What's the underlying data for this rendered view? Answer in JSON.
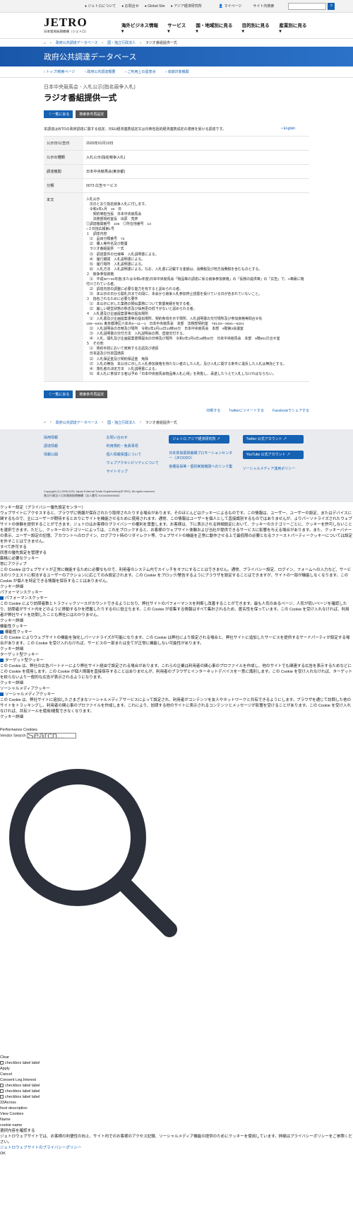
{
  "util": {
    "items": [
      "ジェトロについて",
      "お問合せ",
      "Global Site",
      "アジア経済研究所",
      "マイページ"
    ],
    "search_placeholder": "サイト内検索"
  },
  "header": {
    "logo": "JETRO",
    "logo_sub": "日本貿易振興機構（ジェトロ）",
    "gnav": [
      "海外ビジネス情報 ▾",
      "サービス ▾",
      "国・地域別に見る ▾",
      "目的別に見る ▾",
      "産業別に見る ▾"
    ]
  },
  "breadcrumb": [
    "政府公共調達データベース",
    "国・独立行政法人",
    "ラジオ番組提供一式"
  ],
  "bluebar": "政府公共調達データベース",
  "subnav": [
    "トップ/検索ページ",
    "政府公共調達概要",
    "ご利用上の留意点",
    "収録対象機関"
  ],
  "page": {
    "org": "日本中央競馬会 - 入札公示(指名競争入札)",
    "title": "ラジオ番組提供一式",
    "back_btn": "〈 一覧に戻る",
    "search_btn": "検索条件再設定",
    "note": "本調達はWTOの政府調達に関する協定、日EU経済連携協定又は日英包括的経済連携協定の適用を受ける調達です。",
    "english": "English"
  },
  "table": [
    {
      "label": "公示日/公告日",
      "value": "2020年01月10日"
    },
    {
      "label": "公示の種類",
      "value": "入札公示(指名競争入札)"
    },
    {
      "label": "調達機関",
      "value": "日本中央競馬会(東京都)"
    },
    {
      "label": "分類",
      "value": "0073 広告サービス"
    },
    {
      "label": "本文",
      "value": "入札公示\n　次のとおり指名競争入札に付します。\n　令和2年1月　10　日\n　　契約等担当役　日本中央競馬会\n　　法務部契約室長　出原　亮彦\n◎調達機関番号　236　◎所在地番号　13\n○２日指広報第1号\n１　調達内容\n　⑴　品目分類番号　73\n　⑵　購入等件名及び数量\n　ラジオ番組提供　一式\n　⑶　調達案件の仕様等　入札説明書による。\n　⑷　履行期間　入札説明書による。\n　⑸　履行場所　入札説明書による。\n　⑹　入札方法　入札説明書による。なお、入札書に記載する金額は、消費税及び地方消費税を含むものとする。\n２　競争参加資格\n　⑴　平成30～32年度(または令和2年度)日本中央競馬会「物品等の調達に係る競争参加資格」の「役務の提供等」の「広告」で、A等級に格付けされている者。\n　⑵　調達内容の調整に必要な能力を有すると認められる者。\n　⑶　本公示の日から開札日までの間に、本会から競争入札参加停止措置を受けている日が含まれていないこと。\n３　指名されるために必要な要件\n　⑴　本公示に示した業務の類似業務について数量実績を有する者。\n　⑵　厳しい経営状態の懸念及び採用更の低下がないと認められる者。\n４　入札書及び企画提案書等の提出場所\n　⑴　入札書及び企画提案書等の提出場所、契約条項を示す場所、入札説明書の交付場所及び参加資格等問合せ先\n106―8401 東京都港区六本木6―11―1　日本中央競馬会　本部　法務部契約室　TEL03―3591―5251\n　⑵　入札説明会の日時及び場所　令和2年2月14日13時30分　日本中央競馬会　本部　9階第3会議室\n　⑶　入札説明書の交付方法　入札説明会の際、直接交付する。\n　⑷　入札、開札及び企画提案書類提出の日時及び場所　令和2年3月5日16時30分　日本中央競馬会　本部　9階901打合せ室\n５　その他\n　⑴　契約手続において使用する言語及び通貨\n　日本語及び日本国通貨\n　⑵　入札保証金及び契約保証金　免除\n　⑶　入札の無効　本公示に示した入札参加資格を持たない者のした入札、及び入札に関する条件に違反した入札は無効とする。\n　⑷　落札者の決定方法　入札説明書による。\n　⑸　本入札に参加する者は予め「日本中央競馬会物品等入札心得」を熟覧し、承諾したうえで入札しなければならない。"
    }
  ],
  "share": [
    "印刷する",
    "Twitterにツイートする",
    "Facebookでシェアする"
  ],
  "footer": {
    "col1": [
      "採用情報",
      "調達情報",
      "情報公開"
    ],
    "col2": [
      "お問い合わせ",
      "利用規約・免責事項",
      "個人情報保護について",
      "ウェブアクセシビリティについて",
      "サイトマップ"
    ],
    "btn1": "ジェトロ アジア経済研究所 ↗",
    "list3": [
      "日本貿易振興機構プロモーションセンター（JFOODO）",
      "各種役員等・個別実施機関へのリンク集"
    ],
    "btn2": "Twitter 公式アカウント ↗",
    "btn3": "YouTube 公式アカウント ↗",
    "list4": [
      "ソーシャルメディア運用ポリシー"
    ],
    "copy1": "Copyright (C) 1995-2021 Japan External Trade Organization(JETRO). All rights reserved.",
    "copy2": "独立行政法人日本貿易振興機構（法人番号 2010405003663）"
  },
  "cookie": {
    "title": "クッキー設定（プライバシー優先設定センター）",
    "intro": "ウェブサイトにアクセスすると、ブラウザに情報が保存されたり取得されたりする場合があります。そのほとんどはクッキーによるものです。この情報は、ユーザー、ユーザーの設定、またはデバイスに関するもので、主にユーザーが期待するとおりにサイトを機能させるために使用されます。通常、この情報はユーザーを個人として直接識別するものではありませんが、よりパーソナライズされたウェブサイトの体験を提供することができます。ジェトロはお客様のプライバシーの権利を尊重します。お客様は、下に表示される詳細設定において、クッキーのカテゴリーごとに、クッキーを許可しないことを選択できます。ただし、クッキーのカテゴリーによっては、これをブロックすると、お客様のウェブサイト体験および当社が提供できるサービスに影響を与える場合があります。また、クッキーバナーの表示、ユーザー設定の記憶、アカウントへのログイン、ログアウト時のリダイレクト等、ウェブサイトの機能を正常に動作させる上で最低限の必要となるファーストパーティークッキーについては設定を外すことはできません。",
    "allow_all": "すべて許可する",
    "manage": "同意の優先設定を管理する",
    "strict_h": "厳格に必要なクッキー",
    "always": "常にアクティブ",
    "strict_t": "この Cookie はウェブサイトが正常に機能するために必要なもので、利用者のシステム内でスイッチをオフにすることはできません。通常、プライバシー設定、ログイン、フォームへの入力など、サービスのリクエストに相当するユーザーのアクションに応じてのみ設定されます。この Cookie をブロック/警告するようにブラウザを設定することはできますが、サイトの一部が機能しなくなります。この Cookie が個人を特定できる情報を保存することはありません。",
    "details": "クッキー詳細",
    "perf_h": "パフォーマンスクッキー",
    "perf_t": "この Cookie により訪問者数とトラフィックソースがカウントできるようになり、弊社サイトのパフォーマンスを判断し改善することができます。最も人気のあるページ、人気が低いページを確認したり、訪問者がサイト内をどのように移動するかを把握したりするのに役立ちます。この Cookie が収集する情報はすべて集計されるため、匿名性を保っています。この Cookie を受け入れなければ、利用者が弊社サイトを訪問したことも弊社にはわかりません。",
    "func_h": "機能性クッキー",
    "func_c": "機能性クッキー",
    "func_t": "この Cookie によりウェブサイトの機能を強化しパーソナライズが可能になります。この Cookie は弊社により設定される場合と、弊社サイトに追加したサービスを提供するサードパーティが設定する場合があります。この Cookie を受け入れなければ、サービスの一部または全てが正常に機能しない可能性があります。",
    "target_h": "ターゲット型クッキー",
    "target_c": "ターゲット型クッキー",
    "target_t": "この Cookie は、弊社の広告パートナーにより弊社サイト経由で設定される場合があります。これらの企業は利用者の関心事のプロファイルを作成し、他のサイトでも関連する広告を表示するためなどにこの Cookie を使用します。この Cookie が個人情報を直接保存することはありませんが、利用者のブラウザとインターネットデバイスを一意に識別します。この Cookie を受け入れなければ、ターゲットを絞らないより一般的な広告が表示されるようになります。",
    "social_h": "ソーシャルメディアクッキー",
    "social_c": "ソーシャルメディアクッキー",
    "social_t": "この Cookie は、弊社サイトに追加したさまざまなソーシャルメディアサービスによって設定され、利用者がコンテンツを友人やネットワークと共有できるようにします。ブラウザを通じて訪問した他のサイトをトラッキングし、利用者の関心事のプロファイルを作成します。これにより、訪問する他のサイトに表示されるコンテンツとメッセージが影響を受けることがあります。この Cookie を受け入れなければ、共有ツールを使用/閲覧できなくなります。",
    "perf_cookies": "Performance Cookies",
    "vendor_search": "Vendor Search",
    "search_ph": "Search...",
    "clear": "Clear",
    "cb_label": "checkbox label label",
    "apply": "Apply",
    "cancel": "Cancel",
    "consent": "Consent Leg.Interest",
    "across": "33Across",
    "host": "host description",
    "view": "View Cookies",
    "name": "Name",
    "cookie_name": "cookie name",
    "confirm_h": "選択内容を確認する",
    "confirm_t": "ジェトロウェブサイトでは、お客様の利便性の向上、サイト内でのお客様のアクセス記録、ソーシャルメディア機能の提供のためにクッキーを使用しています。詳細はプライバシーポリシーをご参照ください。",
    "policy_link": "ジェトロウェブサイトのプライバシーポリシー",
    "ok": "OK"
  }
}
